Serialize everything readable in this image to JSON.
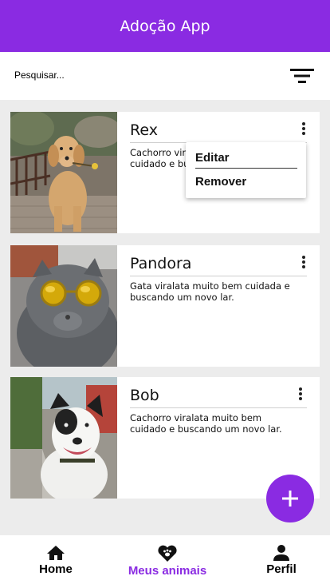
{
  "app": {
    "title": "Adoção App"
  },
  "search": {
    "placeholder": "Pesquisar..."
  },
  "pets": [
    {
      "name": "Rex",
      "description": "Cachorro viralata muito bem cuidado e buscando um novo lar."
    },
    {
      "name": "Pandora",
      "description": "Gata viralata muito bem cuidada e buscando um novo lar."
    },
    {
      "name": "Bob",
      "description": "Cachorro viralata muito bem cuidado e buscando um novo lar."
    }
  ],
  "context_menu": {
    "edit_label": "Editar",
    "remove_label": "Remover"
  },
  "fab": {
    "icon": "plus-icon"
  },
  "bottom_nav": {
    "items": [
      {
        "label": "Home",
        "icon": "home-icon"
      },
      {
        "label": "Meus animais",
        "icon": "heart-paw-icon",
        "active": true
      },
      {
        "label": "Perfil",
        "icon": "person-icon"
      }
    ]
  },
  "colors": {
    "primary": "#8a2be2",
    "background": "#ececec",
    "surface": "#ffffff"
  }
}
